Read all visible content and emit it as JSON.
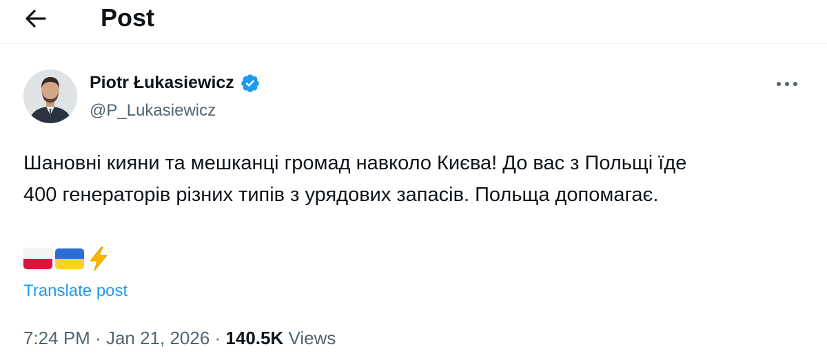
{
  "header": {
    "title": "Post",
    "back_icon": "arrow-left-icon"
  },
  "author": {
    "display_name": "Piotr Łukasiewicz",
    "handle": "@P_Lukasiewicz",
    "verified": true,
    "verified_color": "#1d9bf0"
  },
  "post": {
    "text_line_1": "Шановні кияни та мешканці громад навколо Києва! До вас з Польщі їде",
    "text_line_2": "400 генераторів різних типів з урядових запасів. Польща допомагає.",
    "emojis": [
      "flag-poland",
      "flag-ukraine",
      "high-voltage"
    ],
    "translate_label": "Translate post",
    "time": "7:24 PM",
    "separator": " · ",
    "date": "Jan 21, 2026",
    "views_count": "140.5K",
    "views_label": "Views"
  },
  "colors": {
    "link": "#1d9bf0",
    "secondary_text": "#536471",
    "primary_text": "#0f1419"
  }
}
